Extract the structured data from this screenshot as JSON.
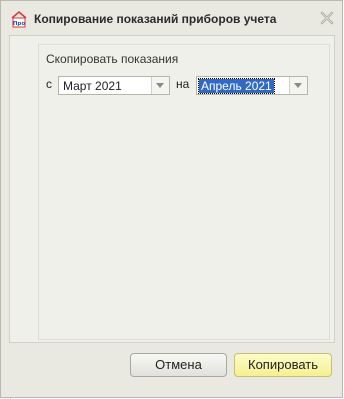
{
  "dialog": {
    "title": "Копирование показаний приборов учета",
    "logo_text": "Про",
    "section_label": "Скопировать показания",
    "from_label": "с",
    "from_value": "Март 2021",
    "to_label": "на",
    "to_value": "Апрель 2021",
    "cancel_label": "Отмена",
    "copy_label": "Копировать"
  },
  "colors": {
    "dialog_bg": "#e9e9e1",
    "primary_button": "#f5f093",
    "selection": "#316ac5"
  },
  "icons": {
    "app_logo": "house-logo-icon",
    "close": "close-x-icon",
    "dropdown": "chevron-down-icon"
  }
}
